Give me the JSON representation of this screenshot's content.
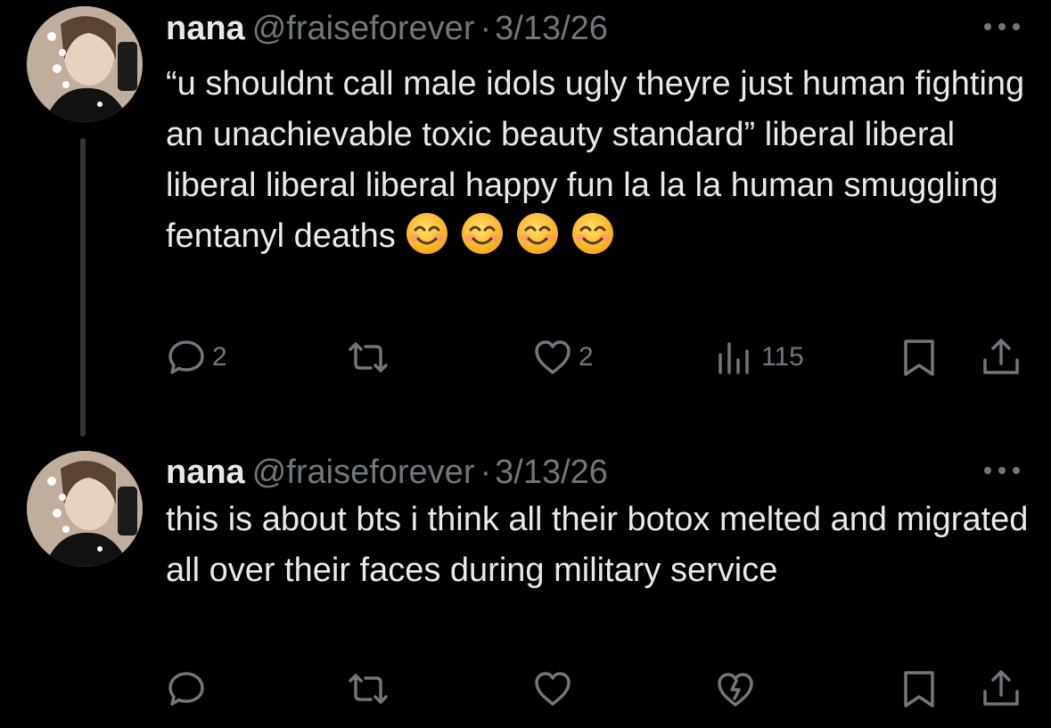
{
  "tweets": [
    {
      "author": {
        "name": "nana",
        "handle": "@fraiseforever"
      },
      "separator": "·",
      "date": "3/13/26",
      "text": "“u shouldnt call male idols ugly theyre just human fighting an unachievable toxic beauty standard” liberal liberal liberal liberal liberal happy fun la la la human smuggling fentanyl deaths",
      "emojis": [
        "smiling-face-with-smiling-eyes",
        "smiling-face-with-smiling-eyes",
        "smiling-face-with-smiling-eyes",
        "smiling-face-with-smiling-eyes"
      ],
      "actions": {
        "reply_count": "2",
        "like_count": "2",
        "views_count": "115"
      }
    },
    {
      "author": {
        "name": "nana",
        "handle": "@fraiseforever"
      },
      "separator": "·",
      "date": "3/13/26",
      "text": "this is about bts i think all their botox melted and migrated all over their faces during military service",
      "actions": {}
    }
  ],
  "colors": {
    "background": "#000000",
    "primary_text": "#e7e9ea",
    "secondary_text": "#71767b",
    "thread_line": "#333639"
  },
  "icons": [
    "more-icon",
    "reply-icon",
    "retweet-icon",
    "like-icon",
    "views-icon",
    "bookmark-icon",
    "share-icon",
    "grok-icon"
  ]
}
